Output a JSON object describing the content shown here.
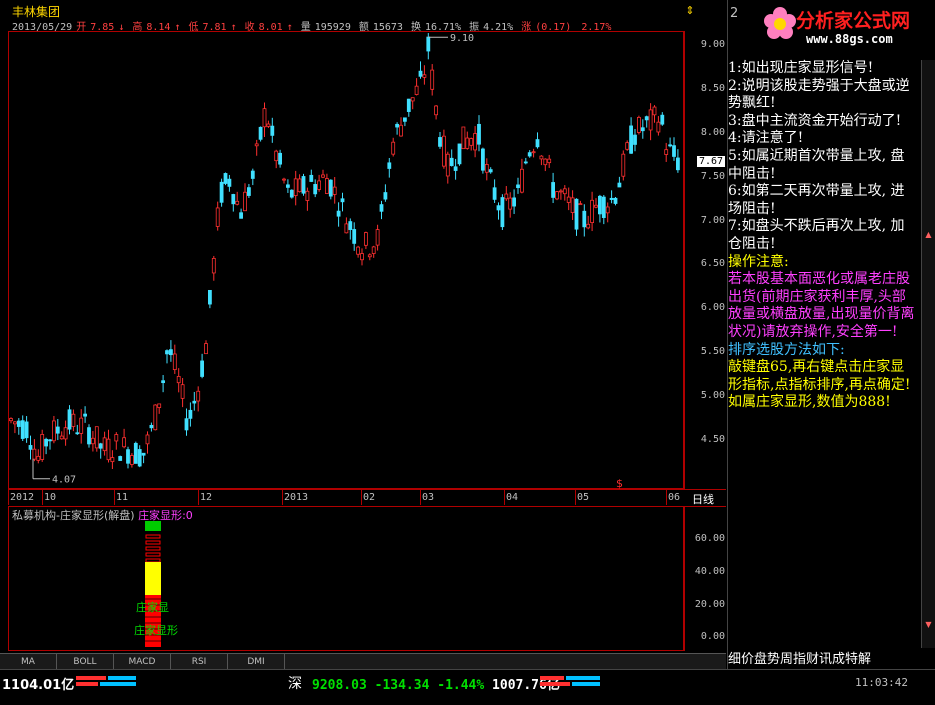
{
  "stock": {
    "name": "丰林集团",
    "date": "2013/05/29",
    "open_label": "开",
    "open": "7.85",
    "open_arrow": "↓",
    "high_label": "高",
    "high": "8.14",
    "high_arrow": "↑",
    "low_label": "低",
    "low": "7.81",
    "low_arrow": "↑",
    "close_label": "收",
    "close": "8.01",
    "close_arrow": "↑",
    "volume_label": "量",
    "volume": "195929",
    "amount_label": "额",
    "amount": "15673",
    "turnover_label": "换",
    "turnover": "16.71%",
    "amplitude_label": "振",
    "amplitude": "4.21%",
    "change_label": "涨",
    "change": "(0.17)",
    "change_pct": "2.17%"
  },
  "main_chart": {
    "price_ticks": [
      "9.00",
      "8.50",
      "8.00",
      "7.50",
      "7.00",
      "6.50",
      "6.00",
      "5.50",
      "5.00",
      "4.50"
    ],
    "current_price": "7.67",
    "high_marker": "9.10",
    "low_marker": "4.07",
    "date_ticks": [
      "2012",
      "10",
      "11",
      "12",
      "2013",
      "02",
      "03",
      "04",
      "05",
      "06"
    ],
    "period_label": "日线",
    "dollar_marker": "$",
    "up_color": "#ff3030",
    "down_color": "#40e0ff"
  },
  "indicator": {
    "name": "私募机构-庄家显形(解盘)",
    "series_name": "庄家显形",
    "value": "0",
    "ticks": [
      "60.00",
      "40.00",
      "20.00",
      "0.00"
    ],
    "stack_labels": [
      "庄家显",
      "庄家显形"
    ],
    "colors": {
      "top": "#00cc00",
      "mid": "#ffff00",
      "bottom": "#ff0000",
      "title_series": "#ff40ff"
    }
  },
  "tabs": [
    "MA",
    "BOLL",
    "MACD",
    "RSI",
    "DMI"
  ],
  "side_panel": {
    "logo_main": "分析家公式网",
    "logo_url": "www.88gs.com",
    "header_fragment": "2",
    "lines": [
      {
        "text": "1:如出现庄家显形信号!",
        "color": "#ffffff"
      },
      {
        "text": "2:说明该股走势强于大盘或逆势飘红!",
        "color": "#ffffff"
      },
      {
        "text": "3:盘中主流资金开始行动了!",
        "color": "#ffffff"
      },
      {
        "text": "4:请注意了!",
        "color": "#ffffff"
      },
      {
        "text": "5:如属近期首次带量上攻, 盘中阻击!",
        "color": "#ffffff"
      },
      {
        "text": "6:如第二天再次带量上攻, 进场阻击!",
        "color": "#ffffff"
      },
      {
        "text": "7:如盘头不跌后再次上攻, 加仓阻击!",
        "color": "#ffffff"
      },
      {
        "text": "操作注意:",
        "color": "#ffff00"
      },
      {
        "text": "若本股基本面恶化或属老庄股出货(前期庄家获利丰厚,头部放量或横盘放量,出现量价背离状况)请放弃操作,安全第一!",
        "color": "#ff40ff"
      },
      {
        "text": "排序选股方法如下:",
        "color": "#40c0ff"
      },
      {
        "text": "敲键盘65,再右键点击庄家显形指标,点指标排序,再点确定!如属庄家显形,数值为888!",
        "color": "#ffff00"
      }
    ],
    "bottom_tabs": "细价盘势周指财讯成特解"
  },
  "status_bar": {
    "left_amount": "1104.01亿",
    "index_name": "深",
    "index_value": "9208.03",
    "index_change": "-134.34",
    "index_pct": "-1.44%",
    "index_amount": "1007.76亿",
    "time": "11:03:42"
  }
}
